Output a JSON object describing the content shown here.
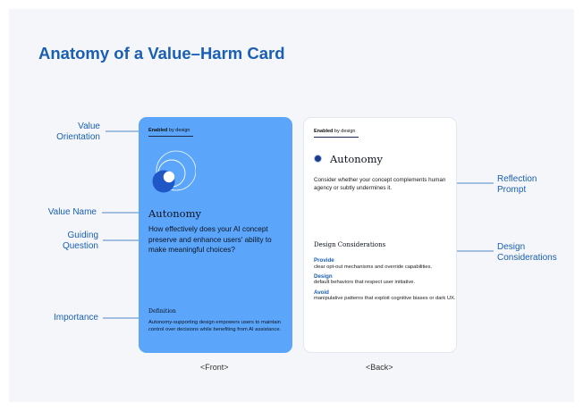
{
  "title": "Anatomy of a Value–Harm Card",
  "labels": {
    "value_orientation": "Value Orientation",
    "value_name": "Value Name",
    "guiding_question": "Guiding Question",
    "importance": "Importance",
    "reflection_prompt": "Reflection Prompt",
    "design_considerations": "Design Considerations"
  },
  "front": {
    "tag_bold": "Enabled",
    "tag_rest": " by design",
    "value_name": "Autonomy",
    "guiding_question": "How effectively does your AI concept preserve and enhance users' ability to make meaningful choices?",
    "definition_heading": "Definition",
    "definition_text": "Autonomy-supporting design empowers users to maintain control over decisions while benefiting from AI assistance.",
    "caption": "<Front>"
  },
  "back": {
    "tag_bold": "Enabled",
    "tag_rest": " by design",
    "value_name": "Autonomy",
    "prompt": "Consider whether your concept complements human agency or subtly undermines it.",
    "considerations_heading": "Design Considerations",
    "considerations": [
      {
        "key": "Provide",
        "text": "clear opt-out mechanisms and override capabilities."
      },
      {
        "key": "Design",
        "text": "default behaviors that respect user initiative."
      },
      {
        "key": "Avoid",
        "text": "manipulative patterns that exploit cognitive biases or dark UX."
      }
    ],
    "caption": "<Back>"
  },
  "colors": {
    "accent": "#1a5fb4",
    "front_card": "#5ba6fb",
    "background": "#f4f6f9"
  }
}
